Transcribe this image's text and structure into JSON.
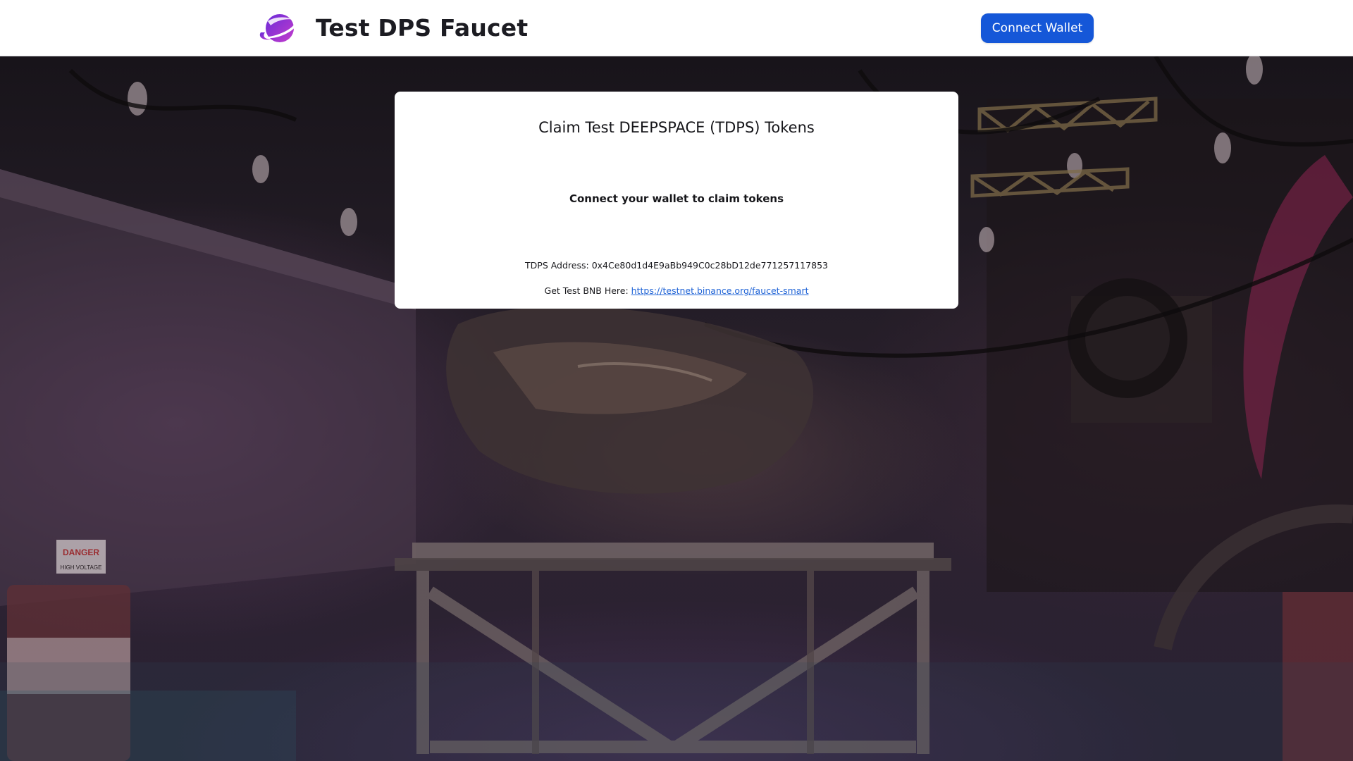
{
  "header": {
    "app_title": "Test DPS Faucet",
    "connect_wallet_label": "Connect Wallet",
    "logo_icon": "planet-swirl-logo-icon"
  },
  "card": {
    "title": "Claim Test DEEPSPACE (TDPS) Tokens",
    "prompt": "Connect your wallet to claim tokens",
    "address_label": "TDPS Address:",
    "address_value": "0x4Ce80d1d4E9aBb949C0c28bD12de771257117853",
    "bnb_label": "Get Test BNB Here:",
    "bnb_link_text": "https://testnet.binance.org/faucet-smart"
  },
  "scene": {
    "sign_danger": "DANGER",
    "sign_voltage": "HIGH VOLTAGE"
  },
  "colors": {
    "accent": "#1557d8",
    "logo_purple": "#7c2bd6",
    "logo_magenta": "#c23cc8",
    "link": "#1f63d6"
  }
}
